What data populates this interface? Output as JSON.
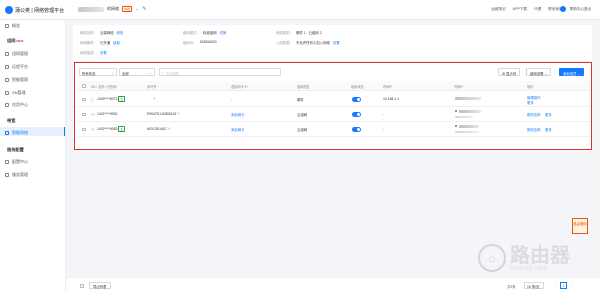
{
  "app": {
    "logo_text": "蒲公英 | 网络管理平台",
    "tenant_name": "的网络",
    "tenant_tag": "旗舰"
  },
  "topnav": [
    "运维笔记",
    "APP下载",
    "代理",
    "联系我们",
    "帮助中心"
  ],
  "user": {
    "name": "退出"
  },
  "sidebar": {
    "overview": "概览",
    "group_network": "组网",
    "group_network_new": "NEW",
    "items_network": [
      "组网管理",
      "远程平台",
      "智能管理",
      "SN管理",
      "应用中心"
    ],
    "group_device": "带宽",
    "device_active": "智能网络",
    "group_service": "服务配置",
    "items_service": [
      "配置中心",
      "服务管理"
    ]
  },
  "info": {
    "row1": [
      {
        "k": "网络名称：",
        "v": "云端网络",
        "link": "修改"
      },
      {
        "k": "组网模式：",
        "v": "标准组网",
        "link": "切换"
      },
      {
        "k": "网络类型：",
        "v": "硬件 1 · 云组网 2",
        "link": ""
      }
    ],
    "row2": [
      {
        "k": "网络服务：",
        "v": "已开通",
        "link": "续费"
      },
      {
        "k": "组网ID：",
        "v": "162806020",
        "link": ""
      },
      {
        "k": "入网权限：",
        "v": "不允许任何人加入网络",
        "link": "设置"
      }
    ],
    "row3": [
      {
        "k": "网络描述：",
        "v": "",
        "link": "设置"
      }
    ]
  },
  "toolbar": {
    "filter1": "所有状态",
    "filter2": "全部",
    "search_placeholder": "SN/名称",
    "display_btn": "显示列",
    "bulk_btn": "组网设置",
    "add_btn": "添加成员"
  },
  "table": {
    "headers": [
      "SN / 名称 / 识别码",
      "序列号",
      "虚拟网卡 IP",
      "组网属性",
      "组网状态",
      "内网IP",
      "外网IP",
      "操作"
    ],
    "rows": [
      {
        "sn": "1049****8373",
        "badge": "主",
        "serial": "",
        "vip": "-",
        "prop": "硬件",
        "lan": "10.168.1.1",
        "op1": "管理操作",
        "op2": "更多"
      },
      {
        "sn": "1402****5052",
        "badge": "",
        "serial": "E9047D1-B3B5124",
        "vip": "添加网卡",
        "prop": "云组网",
        "lan": "-",
        "op1": "修改名称",
        "op2": "更多"
      },
      {
        "sn": "1402****5053",
        "badge": "主",
        "serial": "M21C814AC",
        "vip": "添加网卡",
        "prop": "云组网",
        "lan": "-",
        "op1": "修改名称",
        "op2": "更多"
      }
    ]
  },
  "footer": {
    "export_btn": "导出列表",
    "total": "共3条",
    "page_size": "15 条/页",
    "page": "1"
  },
  "watermark": {
    "main": "路由器",
    "sub": "luyouqi.com",
    "corner": "路由器网"
  },
  "colors": {
    "accent": "#1677ff",
    "highlight_border": "#e03131",
    "success": "#2f9e44"
  }
}
